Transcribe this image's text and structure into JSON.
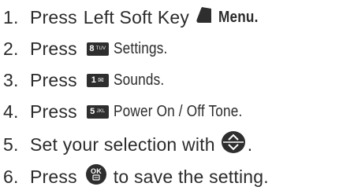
{
  "steps": [
    {
      "number": "1.",
      "lead": "Press",
      "text_a": "Left Soft Key",
      "icon": "left-soft-key-icon",
      "text_b": "Menu."
    },
    {
      "number": "2.",
      "lead": "Press",
      "key_digit": "8",
      "key_letters": "TUV",
      "text": "Settings."
    },
    {
      "number": "3.",
      "lead": "Press",
      "key_digit": "1",
      "key_glyph": "✉",
      "text": "Sounds."
    },
    {
      "number": "4.",
      "lead": "Press",
      "key_digit": "5",
      "key_letters": "JKL",
      "text": "Power On / Off Tone."
    },
    {
      "number": "5.",
      "text_a": "Set your selection with",
      "icon": "directional-key-icon",
      "text_b": "."
    },
    {
      "number": "6.",
      "lead": "Press",
      "icon": "ok-key-icon",
      "text": "to save the setting."
    }
  ]
}
